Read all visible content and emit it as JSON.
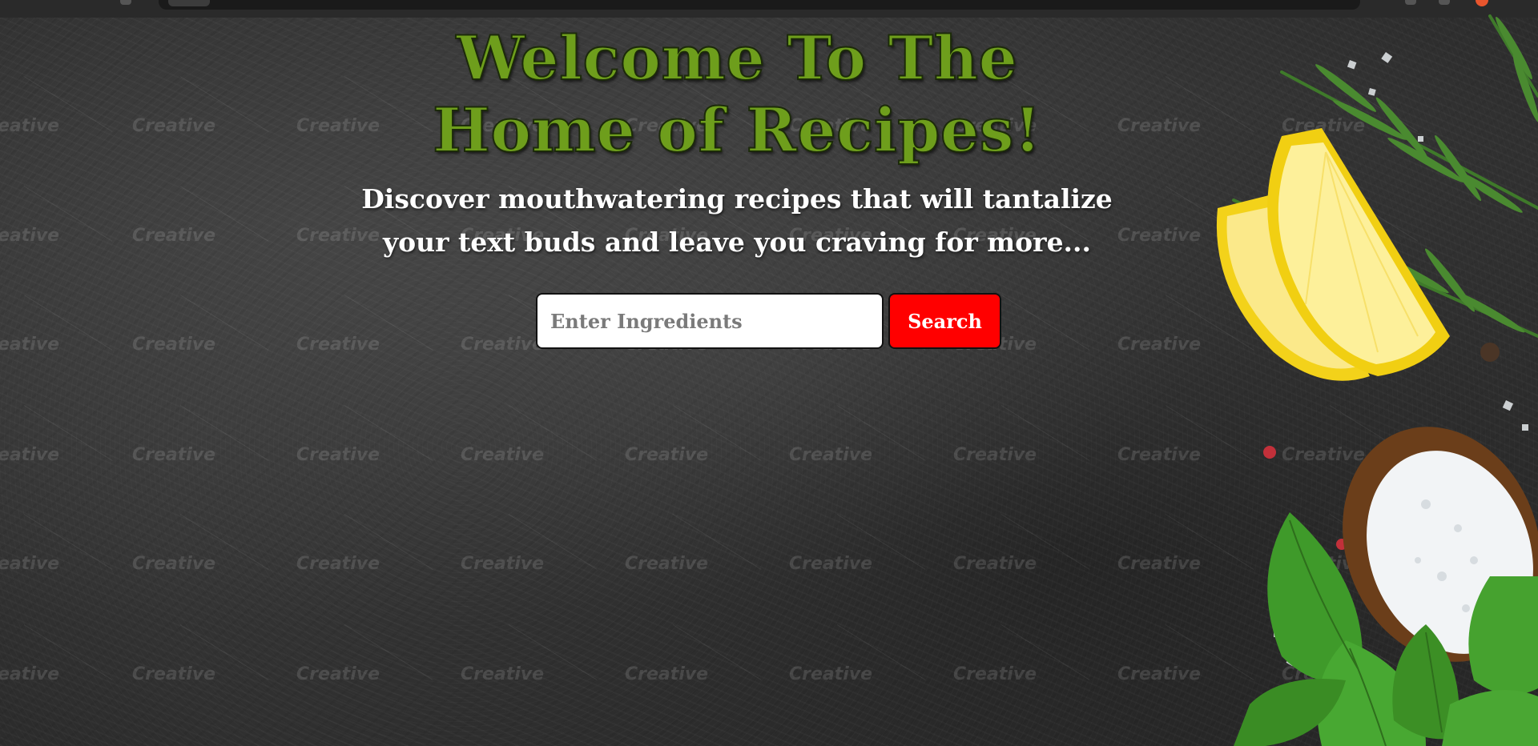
{
  "hero": {
    "title_line1": "Welcome To The",
    "title_line2": "Home of Recipes!",
    "subtitle_line1": "Discover mouthwatering recipes that will tantalize",
    "subtitle_line2": "your text buds and leave you craving for more..."
  },
  "search": {
    "placeholder": "Enter Ingredients",
    "value": "",
    "button_label": "Search"
  },
  "watermark": {
    "text": "Creative"
  },
  "colors": {
    "title_green": "#6e9e1c",
    "button_red": "#ff0000",
    "background": "#3a3a3a"
  }
}
